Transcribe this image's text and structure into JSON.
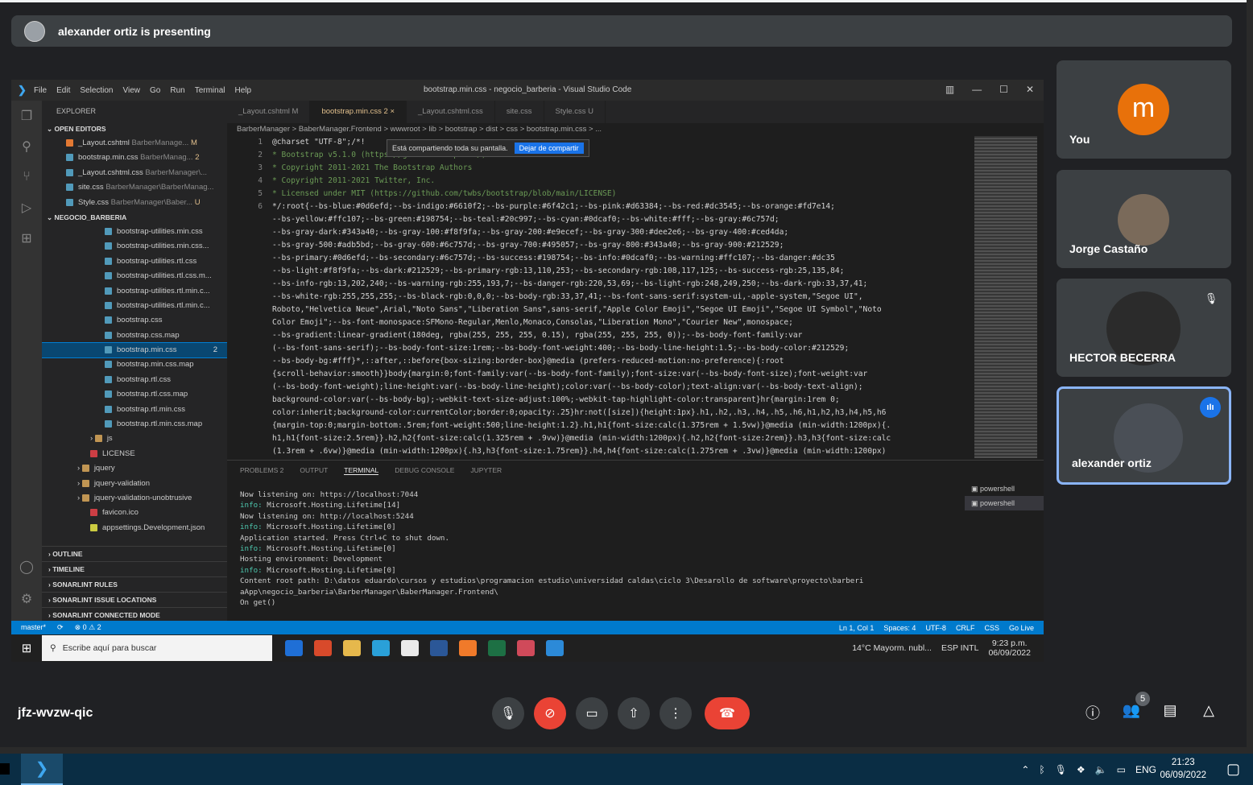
{
  "banner": {
    "text": "alexander ortiz is presenting"
  },
  "vscode": {
    "menu": [
      "File",
      "Edit",
      "Selection",
      "View",
      "Go",
      "Run",
      "Terminal",
      "Help"
    ],
    "window_title": "bootstrap.min.css - negocio_barberia - Visual Studio Code",
    "explorer_title": "EXPLORER",
    "open_editors_label": "OPEN EDITORS",
    "open_editors": [
      {
        "name": "_Layout.cshtml",
        "path": "BarberManage...",
        "badge": "M"
      },
      {
        "name": "bootstrap.min.css",
        "path": "BarberManag...",
        "badge": "2"
      },
      {
        "name": "_Layout.cshtml.css",
        "path": "BarberManager\\...",
        "badge": ""
      },
      {
        "name": "site.css",
        "path": "BarberManager\\BarberManag...",
        "badge": ""
      },
      {
        "name": "Style.css",
        "path": "BarberManager\\Baber...",
        "badge": "U"
      }
    ],
    "folder_label": "NEGOCIO_BARBERIA",
    "files": [
      {
        "name": "bootstrap-utilities.min.css",
        "badge": "",
        "type": "css"
      },
      {
        "name": "bootstrap-utilities.min.css...",
        "badge": "",
        "type": "css"
      },
      {
        "name": "bootstrap-utilities.rtl.css",
        "badge": "",
        "type": "css"
      },
      {
        "name": "bootstrap-utilities.rtl.css.m...",
        "badge": "",
        "type": "css"
      },
      {
        "name": "bootstrap-utilities.rtl.min.c...",
        "badge": "",
        "type": "css"
      },
      {
        "name": "bootstrap-utilities.rtl.min.c...",
        "badge": "",
        "type": "css"
      },
      {
        "name": "bootstrap.css",
        "badge": "",
        "type": "css"
      },
      {
        "name": "bootstrap.css.map",
        "badge": "",
        "type": "css"
      },
      {
        "name": "bootstrap.min.css",
        "badge": "2",
        "type": "css"
      },
      {
        "name": "bootstrap.min.css.map",
        "badge": "",
        "type": "css"
      },
      {
        "name": "bootstrap.rtl.css",
        "badge": "",
        "type": "css"
      },
      {
        "name": "bootstrap.rtl.css.map",
        "badge": "",
        "type": "css"
      },
      {
        "name": "bootstrap.rtl.min.css",
        "badge": "",
        "type": "css"
      },
      {
        "name": "bootstrap.rtl.min.css.map",
        "badge": "",
        "type": "css"
      }
    ],
    "tree_more": [
      {
        "name": "js",
        "type": "folder"
      },
      {
        "name": "LICENSE",
        "type": "lic"
      },
      {
        "name": "jquery",
        "type": "folder"
      },
      {
        "name": "jquery-validation",
        "type": "folder"
      },
      {
        "name": "jquery-validation-unobtrusive",
        "type": "folder"
      },
      {
        "name": "favicon.ico",
        "type": "lic"
      },
      {
        "name": "appsettings.Development.json",
        "type": "json"
      }
    ],
    "bottom_sections": [
      "OUTLINE",
      "TIMELINE",
      "SONARLINT RULES",
      "SONARLINT ISSUE LOCATIONS",
      "SONARLINT CONNECTED MODE"
    ],
    "tabs": [
      {
        "label": "_Layout.cshtml M",
        "active": false
      },
      {
        "label": "bootstrap.min.css 2 ×",
        "active": true
      },
      {
        "label": "_Layout.cshtml.css",
        "active": false
      },
      {
        "label": "site.css",
        "active": false
      },
      {
        "label": "Style.css U",
        "active": false
      }
    ],
    "breadcrumb": "BarberManager > BaberManager.Frontend > wwwroot > lib > bootstrap > dist > css > bootstrap.min.css > ...",
    "share_notice": "Está compartiendo toda su pantalla.",
    "share_stop": "Dejar de compartir",
    "line_numbers": [
      "1",
      "2",
      "3",
      "4",
      "5",
      "6"
    ],
    "code_lines": [
      "@charset \"UTF-8\";/*!",
      " * Bootstrap v5.1.0 (https://getbootstrap.com/)",
      " * Copyright 2011-2021 The Bootstrap Authors",
      " * Copyright 2011-2021 Twitter, Inc.",
      " * Licensed under MIT (https://github.com/twbs/bootstrap/blob/main/LICENSE)",
      " */:root{--bs-blue:#0d6efd;--bs-indigo:#6610f2;--bs-purple:#6f42c1;--bs-pink:#d63384;--bs-red:#dc3545;--bs-orange:#fd7e14;",
      "--bs-yellow:#ffc107;--bs-green:#198754;--bs-teal:#20c997;--bs-cyan:#0dcaf0;--bs-white:#fff;--bs-gray:#6c757d;",
      "--bs-gray-dark:#343a40;--bs-gray-100:#f8f9fa;--bs-gray-200:#e9ecef;--bs-gray-300:#dee2e6;--bs-gray-400:#ced4da;",
      "--bs-gray-500:#adb5bd;--bs-gray-600:#6c757d;--bs-gray-700:#495057;--bs-gray-800:#343a40;--bs-gray-900:#212529;",
      "--bs-primary:#0d6efd;--bs-secondary:#6c757d;--bs-success:#198754;--bs-info:#0dcaf0;--bs-warning:#ffc107;--bs-danger:#dc35",
      "--bs-light:#f8f9fa;--bs-dark:#212529;--bs-primary-rgb:13,110,253;--bs-secondary-rgb:108,117,125;--bs-success-rgb:25,135,84;",
      "--bs-info-rgb:13,202,240;--bs-warning-rgb:255,193,7;--bs-danger-rgb:220,53,69;--bs-light-rgb:248,249,250;--bs-dark-rgb:33,37,41;",
      "--bs-white-rgb:255,255,255;--bs-black-rgb:0,0,0;--bs-body-rgb:33,37,41;--bs-font-sans-serif:system-ui,-apple-system,\"Segoe UI\",",
      "Roboto,\"Helvetica Neue\",Arial,\"Noto Sans\",\"Liberation Sans\",sans-serif,\"Apple Color Emoji\",\"Segoe UI Emoji\",\"Segoe UI Symbol\",\"Noto",
      "Color Emoji\";--bs-font-monospace:SFMono-Regular,Menlo,Monaco,Consolas,\"Liberation Mono\",\"Courier New\",monospace;",
      "--bs-gradient:linear-gradient(180deg, rgba(255, 255, 255, 0.15), rgba(255, 255, 255, 0));--bs-body-font-family:var",
      "(--bs-font-sans-serif);--bs-body-font-size:1rem;--bs-body-font-weight:400;--bs-body-line-height:1.5;--bs-body-color:#212529;",
      "--bs-body-bg:#fff}*,::after,::before{box-sizing:border-box}@media (prefers-reduced-motion:no-preference){:root",
      "{scroll-behavior:smooth}}body{margin:0;font-family:var(--bs-body-font-family);font-size:var(--bs-body-font-size);font-weight:var",
      "(--bs-body-font-weight);line-height:var(--bs-body-line-height);color:var(--bs-body-color);text-align:var(--bs-body-text-align);",
      "background-color:var(--bs-body-bg);-webkit-text-size-adjust:100%;-webkit-tap-highlight-color:transparent}hr{margin:1rem 0;",
      "color:inherit;background-color:currentColor;border:0;opacity:.25}hr:not([size]){height:1px}.h1,.h2,.h3,.h4,.h5,.h6,h1,h2,h3,h4,h5,h6",
      "{margin-top:0;margin-bottom:.5rem;font-weight:500;line-height:1.2}.h1,h1{font-size:calc(1.375rem + 1.5vw)}@media (min-width:1200px){.",
      "h1,h1{font-size:2.5rem}}.h2,h2{font-size:calc(1.325rem + .9vw)}@media (min-width:1200px){.h2,h2{font-size:2rem}}.h3,h3{font-size:calc",
      "(1.3rem + .6vw)}@media (min-width:1200px){.h3,h3{font-size:1.75rem}}.h4,h4{font-size:calc(1.275rem + .3vw)}@media (min-width:1200px)"
    ],
    "panel_tabs": [
      "PROBLEMS 2",
      "OUTPUT",
      "TERMINAL",
      "DEBUG CONSOLE",
      "JUPYTER"
    ],
    "terminal_lines": [
      {
        "p": "",
        "t": "      Now listening on: https://localhost:7044"
      },
      {
        "p": "info:",
        "t": " Microsoft.Hosting.Lifetime[14]"
      },
      {
        "p": "",
        "t": "      Now listening on: http://localhost:5244"
      },
      {
        "p": "info:",
        "t": " Microsoft.Hosting.Lifetime[0]"
      },
      {
        "p": "",
        "t": "      Application started. Press Ctrl+C to shut down."
      },
      {
        "p": "info:",
        "t": " Microsoft.Hosting.Lifetime[0]"
      },
      {
        "p": "",
        "t": "      Hosting environment: Development"
      },
      {
        "p": "info:",
        "t": " Microsoft.Hosting.Lifetime[0]"
      },
      {
        "p": "",
        "t": "      Content root path: D:\\datos eduardo\\cursos y estudios\\programacion estudio\\universidad caldas\\ciclo 3\\Desarollo de software\\proyecto\\barberi"
      },
      {
        "p": "",
        "t": "aApp\\negocio_barberia\\BarberManager\\BaberManager.Frontend\\"
      },
      {
        "p": "",
        "t": "On get()"
      }
    ],
    "terminals": [
      "powershell",
      "powershell"
    ],
    "status_left": [
      "master*",
      "⟳",
      "⊗ 0 ⚠ 2"
    ],
    "status_right": [
      "Ln 1, Col 1",
      "Spaces: 4",
      "UTF-8",
      "CRLF",
      "CSS",
      "Go Live"
    ],
    "win_search": "Escribe aquí para buscar",
    "win_weather": "14°C  Mayorm. nubl...",
    "win_lang": "ESP INTL",
    "win_time": "9:23 p.m.",
    "win_date": "06/09/2022"
  },
  "participants": [
    {
      "name": "You",
      "initial": "m",
      "muted": false,
      "active": false
    },
    {
      "name": "Jorge Castaño",
      "muted": false,
      "active": false
    },
    {
      "name": "HECTOR BECERRA",
      "muted": true,
      "active": false
    },
    {
      "name": "alexander ortiz",
      "muted": false,
      "active": true
    }
  ],
  "meeting": {
    "code": "jfz-wvzw-qic",
    "people_count": "5"
  },
  "taskbar": {
    "lang": "ENG",
    "time": "21:23",
    "date": "06/09/2022"
  },
  "colors": {
    "accent": "#1a73e8",
    "danger": "#ea4335",
    "you_avatar": "#e8710a",
    "vscode_status": "#007acc"
  }
}
